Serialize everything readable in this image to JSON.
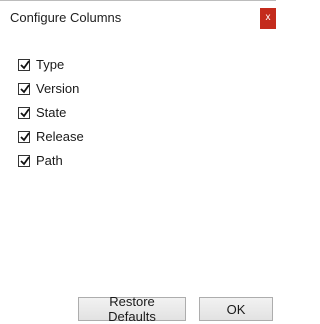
{
  "dialog": {
    "title": "Configure Columns",
    "close_label": "x"
  },
  "columns": [
    {
      "label": "Type",
      "checked": true
    },
    {
      "label": "Version",
      "checked": true
    },
    {
      "label": "State",
      "checked": true
    },
    {
      "label": "Release",
      "checked": true
    },
    {
      "label": "Path",
      "checked": true
    }
  ],
  "buttons": {
    "restore_defaults": "Restore Defaults",
    "ok": "OK"
  },
  "colors": {
    "close_button": "#c42b1c"
  }
}
